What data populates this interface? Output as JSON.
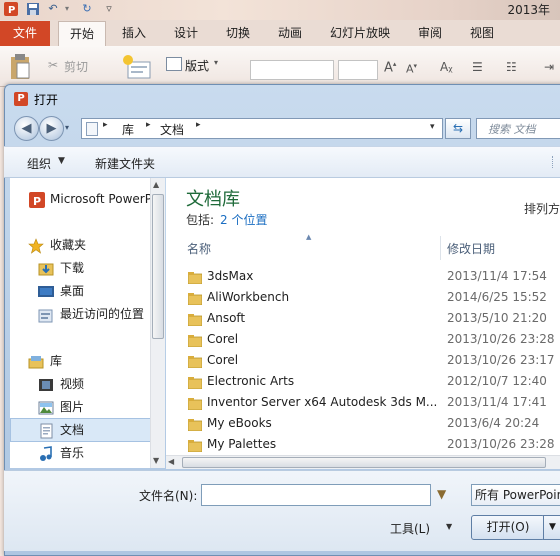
{
  "window": {
    "title_fragment": "2013年"
  },
  "ribbon": {
    "tabs": [
      {
        "label": "文件"
      },
      {
        "label": "开始"
      },
      {
        "label": "插入"
      },
      {
        "label": "设计"
      },
      {
        "label": "切换"
      },
      {
        "label": "动画"
      },
      {
        "label": "幻灯片放映"
      },
      {
        "label": "审阅"
      },
      {
        "label": "视图"
      }
    ],
    "cut_label": "剪切",
    "layout_label": "版式"
  },
  "dialog": {
    "title": "打开",
    "breadcrumb": [
      "库",
      "文档"
    ],
    "search_placeholder": "搜索 文档",
    "toolbar": {
      "organize": "组织",
      "new_folder": "新建文件夹"
    },
    "nav": {
      "app": "Microsoft PowerPoint",
      "favorites": "收藏夹",
      "downloads": "下载",
      "desktop": "桌面",
      "recent": "最近访问的位置",
      "libraries": "库",
      "videos": "视频",
      "pictures": "图片",
      "documents": "文档",
      "music": "音乐"
    },
    "library": {
      "heading": "文档库",
      "includes_label": "包括:",
      "includes_link": "2 个位置",
      "arrange_label": "排列方"
    },
    "columns": {
      "name": "名称",
      "date": "修改日期"
    },
    "files": [
      {
        "name": "3dsMax",
        "date": "2013/11/4 17:54"
      },
      {
        "name": "AliWorkbench",
        "date": "2014/6/25 15:52"
      },
      {
        "name": "Ansoft",
        "date": "2013/5/10 21:20"
      },
      {
        "name": "Corel",
        "date": "2013/10/26 23:28"
      },
      {
        "name": "Corel",
        "date": "2013/10/26 23:17"
      },
      {
        "name": "Electronic Arts",
        "date": "2012/10/7 12:40"
      },
      {
        "name": "Inventor Server x64 Autodesk 3ds M...",
        "date": "2013/11/4 17:41"
      },
      {
        "name": "My eBooks",
        "date": "2013/6/4 20:24"
      },
      {
        "name": "My Palettes",
        "date": "2013/10/26 23:28"
      }
    ],
    "filename_label": "文件名(N):",
    "filename_value": "",
    "filetype_value": "所有 PowerPoint",
    "tools_label": "工具(L)",
    "open_label": "打开(O)"
  },
  "colors": {
    "accent": "#d24726",
    "library_heading": "#1e6a39",
    "link": "#1b6ec2"
  }
}
